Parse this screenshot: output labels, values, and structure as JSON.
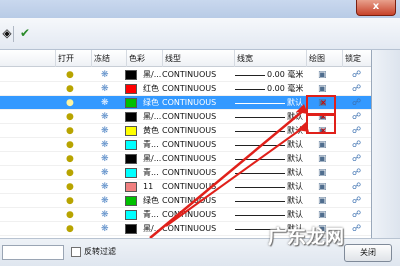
{
  "window": {
    "close_glyph": "x"
  },
  "toolbar": {
    "icons": [
      "pin-icon",
      "checkmark-icon"
    ],
    "check_color": "#2a8a2a"
  },
  "columns": {
    "on": "打开",
    "freeze": "冻结",
    "color": "色彩",
    "linetype": "线型",
    "lineweight": "线宽",
    "plot": "绘图",
    "lock": "锁定"
  },
  "rows": [
    {
      "color_hex": "#000000",
      "color_name": "黑/...",
      "linetype": "CONTINUOUS",
      "lineweight": "0.00 毫米",
      "selected": false,
      "no_plot": false
    },
    {
      "color_hex": "#ff0000",
      "color_name": "红色",
      "linetype": "CONTINUOUS",
      "lineweight": "0.00 毫米",
      "selected": false,
      "no_plot": false
    },
    {
      "color_hex": "#00c000",
      "color_name": "绿色",
      "linetype": "CONTINUOUS",
      "lineweight": "默认",
      "selected": true,
      "no_plot": true
    },
    {
      "color_hex": "#000000",
      "color_name": "黑/...",
      "linetype": "CONTINUOUS",
      "lineweight": "默认",
      "selected": false,
      "no_plot": true
    },
    {
      "color_hex": "#ffff00",
      "color_name": "黄色",
      "linetype": "CONTINUOUS",
      "lineweight": "默认",
      "selected": false,
      "no_plot": true
    },
    {
      "color_hex": "#00ffff",
      "color_name": "青...",
      "linetype": "CONTINUOUS",
      "lineweight": "默认",
      "selected": false,
      "no_plot": false
    },
    {
      "color_hex": "#000000",
      "color_name": "黑/...",
      "linetype": "CONTINUOUS",
      "lineweight": "默认",
      "selected": false,
      "no_plot": false
    },
    {
      "color_hex": "#00ffff",
      "color_name": "青...",
      "linetype": "CONTINUOUS",
      "lineweight": "默认",
      "selected": false,
      "no_plot": false
    },
    {
      "color_hex": "#f08080",
      "color_name": "11",
      "linetype": "CONTINUOUS",
      "lineweight": "默认",
      "selected": false,
      "no_plot": false
    },
    {
      "color_hex": "#00c000",
      "color_name": "绿色",
      "linetype": "CONTINUOUS",
      "lineweight": "默认",
      "selected": false,
      "no_plot": false
    },
    {
      "color_hex": "#00ffff",
      "color_name": "青...",
      "linetype": "CONTINUOUS",
      "lineweight": "默认",
      "selected": false,
      "no_plot": false
    },
    {
      "color_hex": "#000000",
      "color_name": "黑/...",
      "linetype": "CONTINUOUS",
      "lineweight": "默认",
      "selected": false,
      "no_plot": false
    }
  ],
  "bottom": {
    "invert_filter_label": "反转过滤",
    "close_label": "关闭",
    "watermark": "广东龙网"
  },
  "annotation": {
    "color": "#e0201a"
  }
}
